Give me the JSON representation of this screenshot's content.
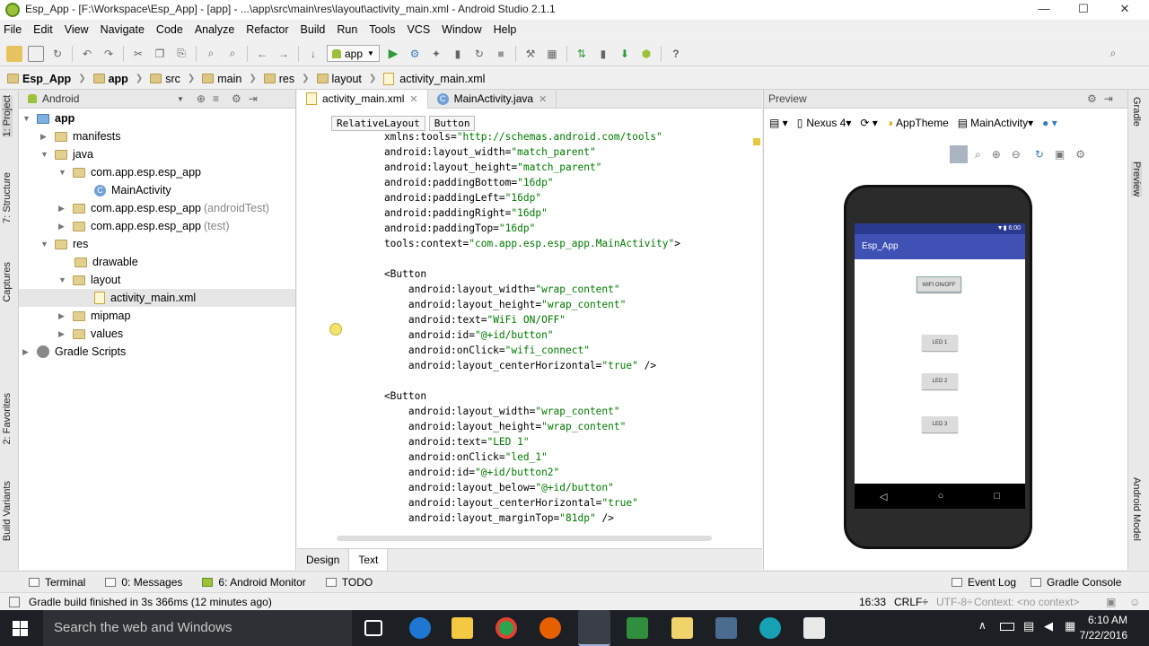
{
  "window": {
    "title": "Esp_App - [F:\\Workspace\\Esp_App] - [app] - ...\\app\\src\\main\\res\\layout\\activity_main.xml - Android Studio 2.1.1"
  },
  "menu": [
    "File",
    "Edit",
    "View",
    "Navigate",
    "Code",
    "Analyze",
    "Refactor",
    "Build",
    "Run",
    "Tools",
    "VCS",
    "Window",
    "Help"
  ],
  "toolbar": {
    "run_config": "app"
  },
  "breadcrumb": [
    "Esp_App",
    "app",
    "src",
    "main",
    "res",
    "layout",
    "activity_main.xml"
  ],
  "side_tabs_left": [
    "1: Project",
    "7: Structure",
    "Captures",
    "2: Favorites",
    "Build Variants"
  ],
  "side_tabs_right": [
    "Gradle",
    "Preview",
    "Android Model"
  ],
  "project": {
    "view_selector": "Android",
    "tree": [
      {
        "label": "app",
        "suffix": ""
      },
      {
        "label": "manifests",
        "suffix": ""
      },
      {
        "label": "java",
        "suffix": ""
      },
      {
        "label": "com.app.esp.esp_app",
        "suffix": ""
      },
      {
        "label": "MainActivity",
        "suffix": ""
      },
      {
        "label": "com.app.esp.esp_app",
        "suffix": "(androidTest)"
      },
      {
        "label": "com.app.esp.esp_app",
        "suffix": "(test)"
      },
      {
        "label": "res",
        "suffix": ""
      },
      {
        "label": "drawable",
        "suffix": ""
      },
      {
        "label": "layout",
        "suffix": ""
      },
      {
        "label": "activity_main.xml",
        "suffix": ""
      },
      {
        "label": "mipmap",
        "suffix": ""
      },
      {
        "label": "values",
        "suffix": ""
      },
      {
        "label": "Gradle Scripts",
        "suffix": ""
      }
    ]
  },
  "editor": {
    "tabs": [
      "activity_main.xml",
      "MainActivity.java"
    ],
    "crumbs": [
      "RelativeLayout",
      "Button"
    ],
    "lines": [
      {
        "a": "    xmlns:tools=",
        "v": "\"http://schemas.android.com/tools\"",
        "e": ""
      },
      {
        "a": "    android:layout_width=",
        "v": "\"match_parent\"",
        "e": ""
      },
      {
        "a": "    android:layout_height=",
        "v": "\"match_parent\"",
        "e": ""
      },
      {
        "a": "    android:paddingBottom=",
        "v": "\"16dp\"",
        "e": ""
      },
      {
        "a": "    android:paddingLeft=",
        "v": "\"16dp\"",
        "e": ""
      },
      {
        "a": "    android:paddingRight=",
        "v": "\"16dp\"",
        "e": ""
      },
      {
        "a": "    android:paddingTop=",
        "v": "\"16dp\"",
        "e": ""
      },
      {
        "a": "    tools:context=",
        "v": "\"com.app.esp.esp_app.MainActivity\"",
        "e": ">"
      },
      {
        "a": "",
        "v": "",
        "e": ""
      },
      {
        "a": "    <Button",
        "v": "",
        "e": ""
      },
      {
        "a": "        android:layout_width=",
        "v": "\"wrap_content\"",
        "e": ""
      },
      {
        "a": "        android:layout_height=",
        "v": "\"wrap_content\"",
        "e": ""
      },
      {
        "a": "        android:text=",
        "v": "\"WiFi ON/OFF\"",
        "e": ""
      },
      {
        "a": "        android:id=",
        "v": "\"@+id/button\"",
        "e": ""
      },
      {
        "a": "        android:onClick=",
        "v": "\"wifi_connect\"",
        "e": ""
      },
      {
        "a": "        android:layout_centerHorizontal=",
        "v": "\"true\"",
        "e": " />"
      },
      {
        "a": "",
        "v": "",
        "e": ""
      },
      {
        "a": "    <Button",
        "v": "",
        "e": ""
      },
      {
        "a": "        android:layout_width=",
        "v": "\"wrap_content\"",
        "e": ""
      },
      {
        "a": "        android:layout_height=",
        "v": "\"wrap_content\"",
        "e": ""
      },
      {
        "a": "        android:text=",
        "v": "\"LED 1\"",
        "e": ""
      },
      {
        "a": "        android:onClick=",
        "v": "\"led_1\"",
        "e": ""
      },
      {
        "a": "        android:id=",
        "v": "\"@+id/button2\"",
        "e": ""
      },
      {
        "a": "        android:layout_below=",
        "v": "\"@+id/button\"",
        "e": ""
      },
      {
        "a": "        android:layout_centerHorizontal=",
        "v": "\"true\"",
        "e": ""
      },
      {
        "a": "        android:layout_marginTop=",
        "v": "\"81dp\"",
        "e": " />"
      }
    ],
    "bottom_tabs": [
      "Design",
      "Text"
    ]
  },
  "preview": {
    "title": "Preview",
    "device": "Nexus 4",
    "theme": "AppTheme",
    "activity": "MainActivity",
    "app_title": "Esp_App",
    "status_time": "6:00",
    "buttons": [
      "WIFI ON/OFF",
      "LED 1",
      "LED 2",
      "LED 3"
    ]
  },
  "tool_windows": [
    "Terminal",
    "0: Messages",
    "6: Android Monitor",
    "TODO",
    "Event Log",
    "Gradle Console"
  ],
  "status": {
    "message": "Gradle build finished in 3s 366ms (12 minutes ago)",
    "position": "16:33",
    "line_sep": "CRLF÷",
    "encoding": "UTF-8÷",
    "context": "Context: <no context>"
  },
  "taskbar": {
    "search_placeholder": "Search the web and Windows",
    "time": "6:10 AM",
    "date": "7/22/2016"
  }
}
